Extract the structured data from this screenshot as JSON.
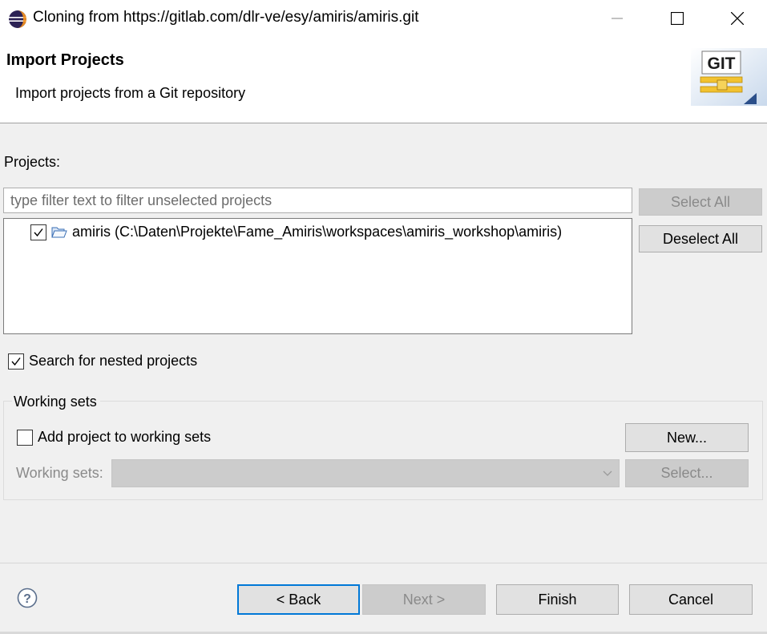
{
  "window": {
    "title": "Cloning from https://gitlab.com/dlr-ve/esy/amiris/amiris.git",
    "controls": [
      "minimize-icon",
      "maximize-icon",
      "close-icon"
    ]
  },
  "header": {
    "title": "Import Projects",
    "description": "Import projects from a Git repository",
    "banner_icon": "git-icon",
    "banner_text": "GIT"
  },
  "projects": {
    "label": "Projects:",
    "filter_placeholder": "type filter text to filter unselected projects",
    "filter_value": "",
    "items": [
      {
        "label": "amiris (C:\\Daten\\Projekte\\Fame_Amiris\\workspaces\\amiris_workshop\\amiris)",
        "checked": true,
        "icon": "folder-open-icon"
      }
    ],
    "select_all_label": "Select All",
    "deselect_all_label": "Deselect All"
  },
  "options": {
    "nested_label": "Search for nested projects",
    "nested_checked": true
  },
  "working_sets": {
    "group_title": "Working sets",
    "add_label": "Add project to working sets",
    "add_checked": false,
    "new_label": "New...",
    "sets_label": "Working sets:",
    "sets_value": "",
    "select_label": "Select..."
  },
  "footer": {
    "help_icon": "help-icon",
    "back_label": "< Back",
    "next_label": "Next >",
    "finish_label": "Finish",
    "cancel_label": "Cancel"
  },
  "colors": {
    "focus_border": "#0078d7",
    "disabled_text": "#8a8a8a",
    "button_bg": "#e1e1e1",
    "dialog_bg": "#f0f0f0"
  }
}
